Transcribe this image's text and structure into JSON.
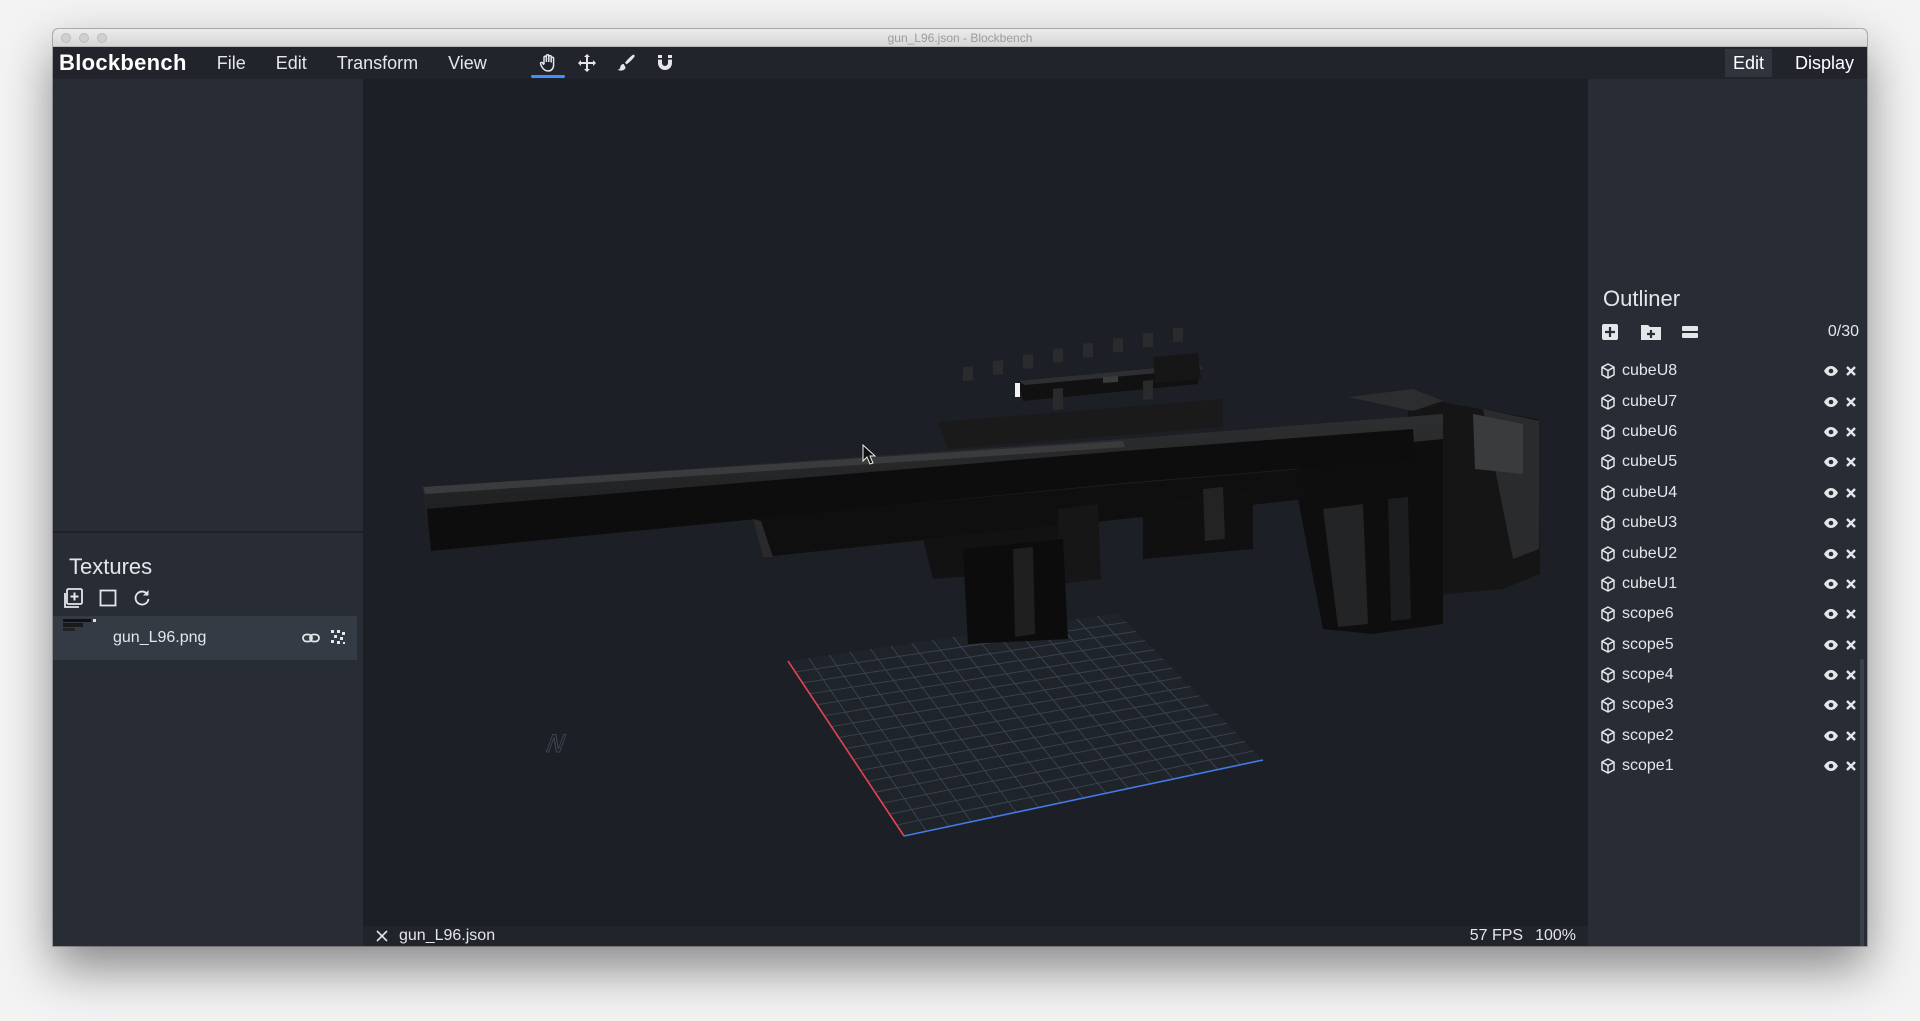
{
  "window": {
    "title": "gun_L96.json - Blockbench"
  },
  "menubar": {
    "logo": "Blockbench",
    "menus": [
      "File",
      "Edit",
      "Transform",
      "View"
    ],
    "tools": [
      {
        "icon": "hand-icon",
        "active": true
      },
      {
        "icon": "move-icon",
        "active": false
      },
      {
        "icon": "brush-icon",
        "active": false
      },
      {
        "icon": "magnet-icon",
        "active": false
      }
    ],
    "modes": [
      {
        "label": "Edit",
        "active": true
      },
      {
        "label": "Display",
        "active": false
      }
    ]
  },
  "textures": {
    "title": "Textures",
    "items": [
      {
        "name": "gun_L96.png"
      }
    ]
  },
  "outliner": {
    "title": "Outliner",
    "count": "0/30",
    "items": [
      "cubeU8",
      "cubeU7",
      "cubeU6",
      "cubeU5",
      "cubeU4",
      "cubeU3",
      "cubeU2",
      "cubeU1",
      "scope6",
      "scope5",
      "scope4",
      "scope3",
      "scope2",
      "scope1"
    ]
  },
  "status": {
    "file": "gun_L96.json",
    "fps": "57 FPS",
    "zoom": "100%"
  },
  "colors": {
    "accent": "#3e90ff",
    "panel": "#282c34",
    "viewport": "#1c1f25",
    "grid_x_axis": "#e0454f",
    "grid_z_axis": "#4479e8"
  }
}
